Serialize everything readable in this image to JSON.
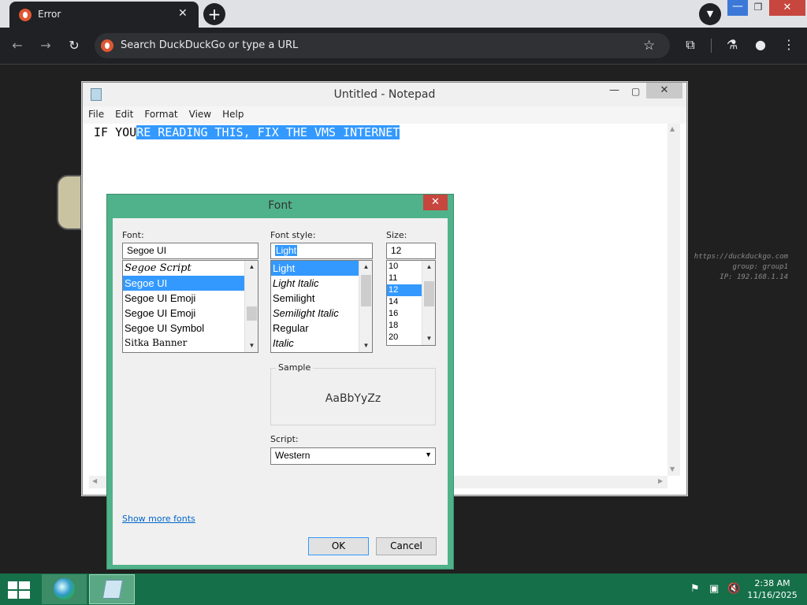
{
  "browser": {
    "tab_title": "Error",
    "new_tab_symbol": "+",
    "omnibox_placeholder": "Search DuckDuckGo or type a URL"
  },
  "desktop_info": {
    "line1": "https://duckduckgo.com",
    "line2": "group: group1",
    "line3": "IP: 192.168.1.14"
  },
  "notepad": {
    "title": "Untitled - Notepad",
    "menu": [
      "File",
      "Edit",
      "Format",
      "View",
      "Help"
    ],
    "text_unselected": "IF YOU",
    "text_selected": "RE READING THIS, FIX THE VMS INTERNET"
  },
  "font_dialog": {
    "title": "Font",
    "font_label": "Font:",
    "font_value": "Segoe UI",
    "font_list": [
      "Segoe Script",
      "Segoe UI",
      "Segoe UI Emoji",
      "Segoe UI Emoji",
      "Segoe UI Symbol",
      "Sitka Banner"
    ],
    "font_selected_index": 1,
    "style_label": "Font style:",
    "style_value": "Light",
    "style_list": [
      "Light",
      "Light Italic",
      "Semilight",
      "Semilight Italic",
      "Regular",
      "Italic"
    ],
    "style_selected_index": 0,
    "size_label": "Size:",
    "size_value": "12",
    "size_list": [
      "10",
      "11",
      "12",
      "14",
      "16",
      "18",
      "20"
    ],
    "size_selected_index": 2,
    "sample_label": "Sample",
    "sample_text": "AaBbYyZz",
    "script_label": "Script:",
    "script_value": "Western",
    "show_more_link": "Show more fonts",
    "ok_label": "OK",
    "cancel_label": "Cancel",
    "close_symbol": "✕"
  },
  "taskbar": {
    "time": "2:38 AM",
    "date": "11/16/2025"
  },
  "colors": {
    "selection": "#3399ff",
    "taskbar": "#156f49",
    "dialog_frame": "#50b28a",
    "close_red": "#c7463e",
    "link": "#0066cc"
  }
}
